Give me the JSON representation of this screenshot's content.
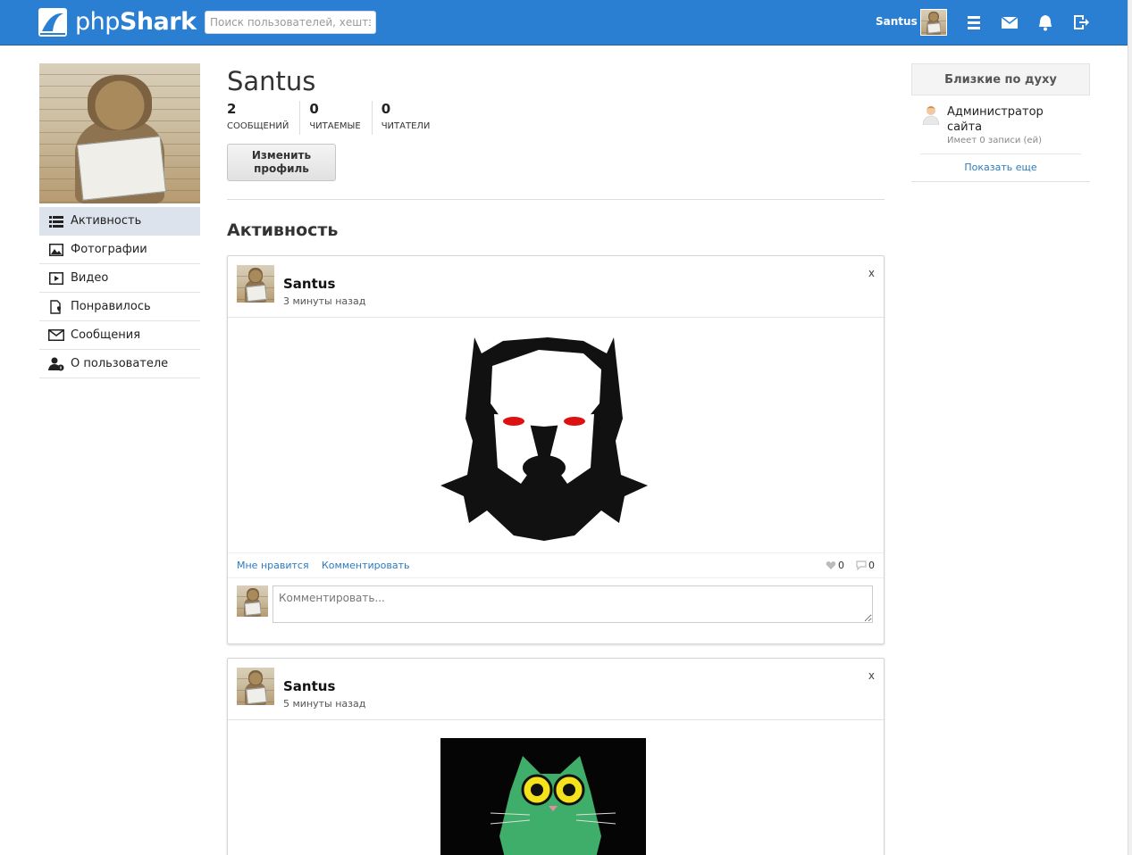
{
  "header": {
    "logo_text_light": "php",
    "logo_text_bold": "Shark",
    "search_placeholder": "Поиск пользователей, хештэгов",
    "username": "Santus",
    "icons": [
      "menu-icon",
      "mail-icon",
      "bell-icon",
      "logout-icon"
    ],
    "brand_color": "#2b7fd3"
  },
  "sidebar": {
    "items": [
      {
        "label": "Активность",
        "icon": "activity-icon",
        "active": true
      },
      {
        "label": "Фотографии",
        "icon": "photo-icon",
        "active": false
      },
      {
        "label": "Видео",
        "icon": "video-icon",
        "active": false
      },
      {
        "label": "Понравилось",
        "icon": "liked-icon",
        "active": false
      },
      {
        "label": "Сообщения",
        "icon": "envelope-icon",
        "active": false
      },
      {
        "label": "О пользователе",
        "icon": "user-info-icon",
        "active": false
      }
    ]
  },
  "profile": {
    "name": "Santus",
    "stats": [
      {
        "value": "2",
        "label": "СООБЩЕНИЙ"
      },
      {
        "value": "0",
        "label": "ЧИТАЕМЫЕ"
      },
      {
        "value": "0",
        "label": "ЧИТАТЕЛИ"
      }
    ],
    "edit_button": "Изменить профиль"
  },
  "activity": {
    "title": "Активность",
    "posts": [
      {
        "author": "Santus",
        "time": "3 минуты назад",
        "close": "x",
        "like_label": "Мне нравится",
        "comment_label": "Комментировать",
        "likes": "0",
        "comments": "0",
        "comment_placeholder": "Комментировать..."
      },
      {
        "author": "Santus",
        "time": "5 минуты назад",
        "close": "x"
      }
    ]
  },
  "right": {
    "title": "Близкие по духу",
    "user_name": "Администратор сайта",
    "user_sub": "Имеет 0 записи (ей)",
    "show_more": "Показать еще"
  }
}
